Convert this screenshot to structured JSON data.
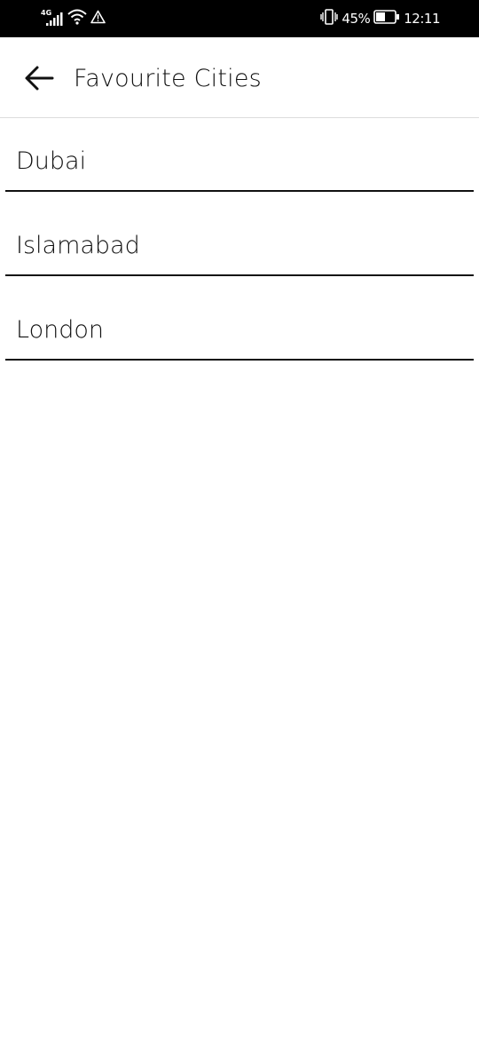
{
  "status_bar": {
    "network": "4G",
    "battery_percent": "45%",
    "time": "12:11",
    "icons": [
      "signal-icon",
      "wifi-icon",
      "warning-icon",
      "vibrate-icon",
      "battery-icon"
    ]
  },
  "app_bar": {
    "title": "Favourite Cities",
    "back_icon": "arrow-left-icon"
  },
  "cities": [
    {
      "name": "Dubai"
    },
    {
      "name": "Islamabad"
    },
    {
      "name": "London"
    }
  ],
  "colors": {
    "status_bar_bg": "#000000",
    "background": "#ffffff",
    "text": "#111111",
    "divider": "#111111",
    "app_bar_border": "#dcdcdc"
  }
}
